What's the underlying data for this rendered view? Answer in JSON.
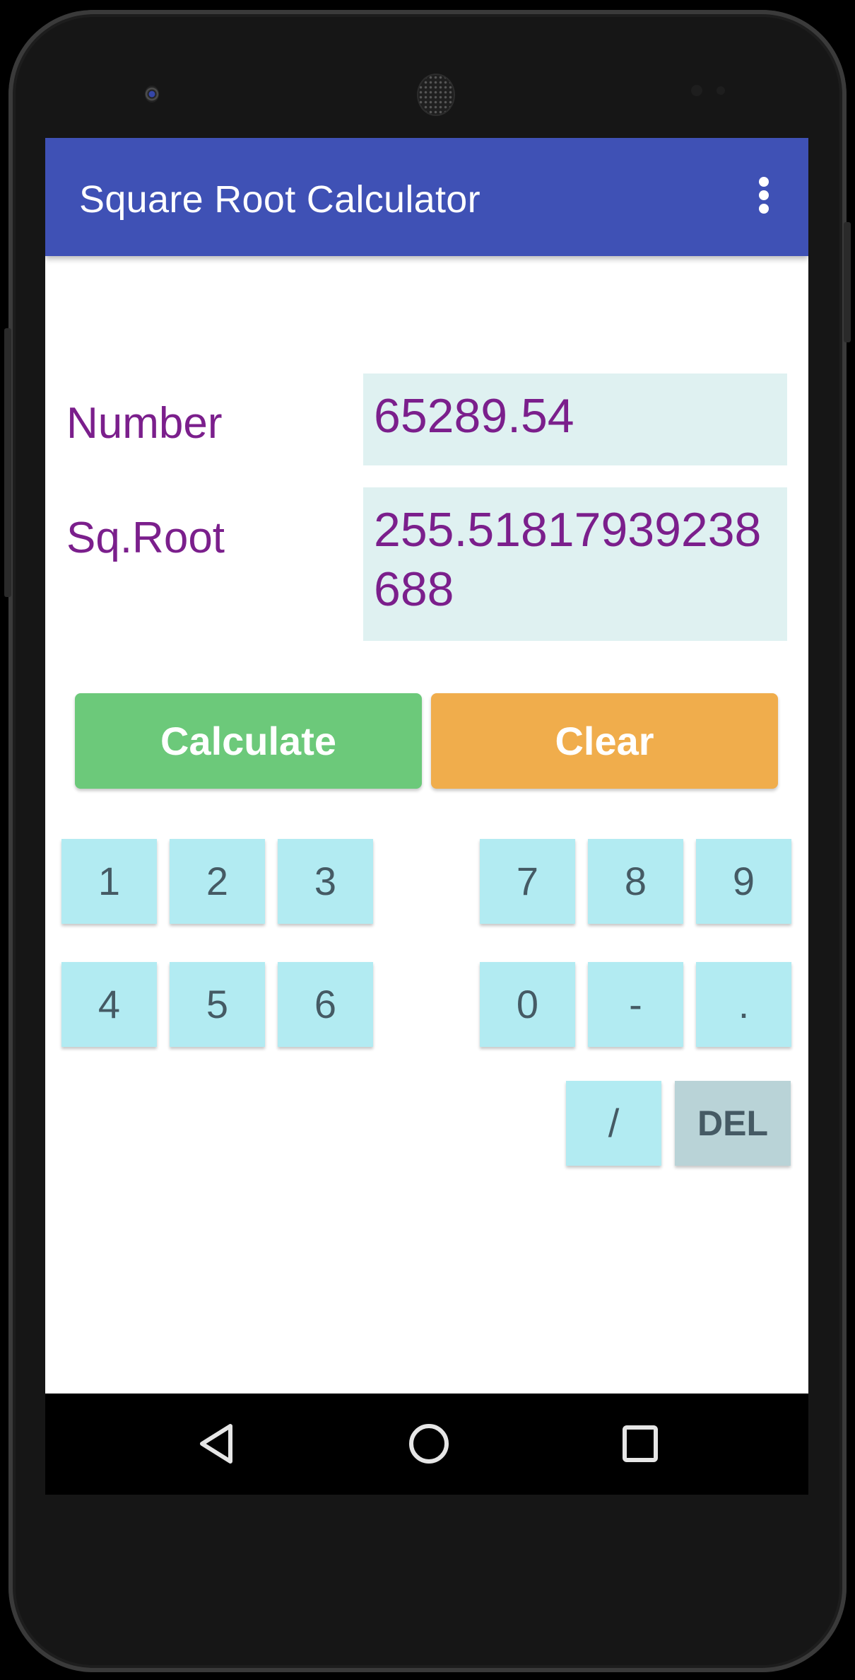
{
  "app": {
    "title": "Square Root Calculator",
    "menu_icon": "more-vert-icon",
    "colors": {
      "app_bar": "#3F51B5",
      "label_text": "#7B1F8C",
      "field_bg": "#DFF1F1",
      "calculate": "#6CC97A",
      "clear": "#F0AD4C",
      "key_bg": "#B2EBF2",
      "del_bg": "#B9D3D7",
      "key_text": "#455A64"
    }
  },
  "form": {
    "number_label": "Number",
    "number_value": "65289.54",
    "sqrt_label": "Sq.Root",
    "sqrt_value": "255.51817939238688"
  },
  "actions": {
    "calculate_label": "Calculate",
    "clear_label": "Clear"
  },
  "keypad": {
    "left_row1": [
      "1",
      "2",
      "3"
    ],
    "left_row2": [
      "4",
      "5",
      "6"
    ],
    "right_row1": [
      "7",
      "8",
      "9"
    ],
    "right_row2": [
      "0",
      "-",
      "."
    ],
    "row3": [
      "/",
      "DEL"
    ]
  },
  "navbar": {
    "back": "back-icon",
    "home": "home-icon",
    "recents": "recents-icon"
  }
}
